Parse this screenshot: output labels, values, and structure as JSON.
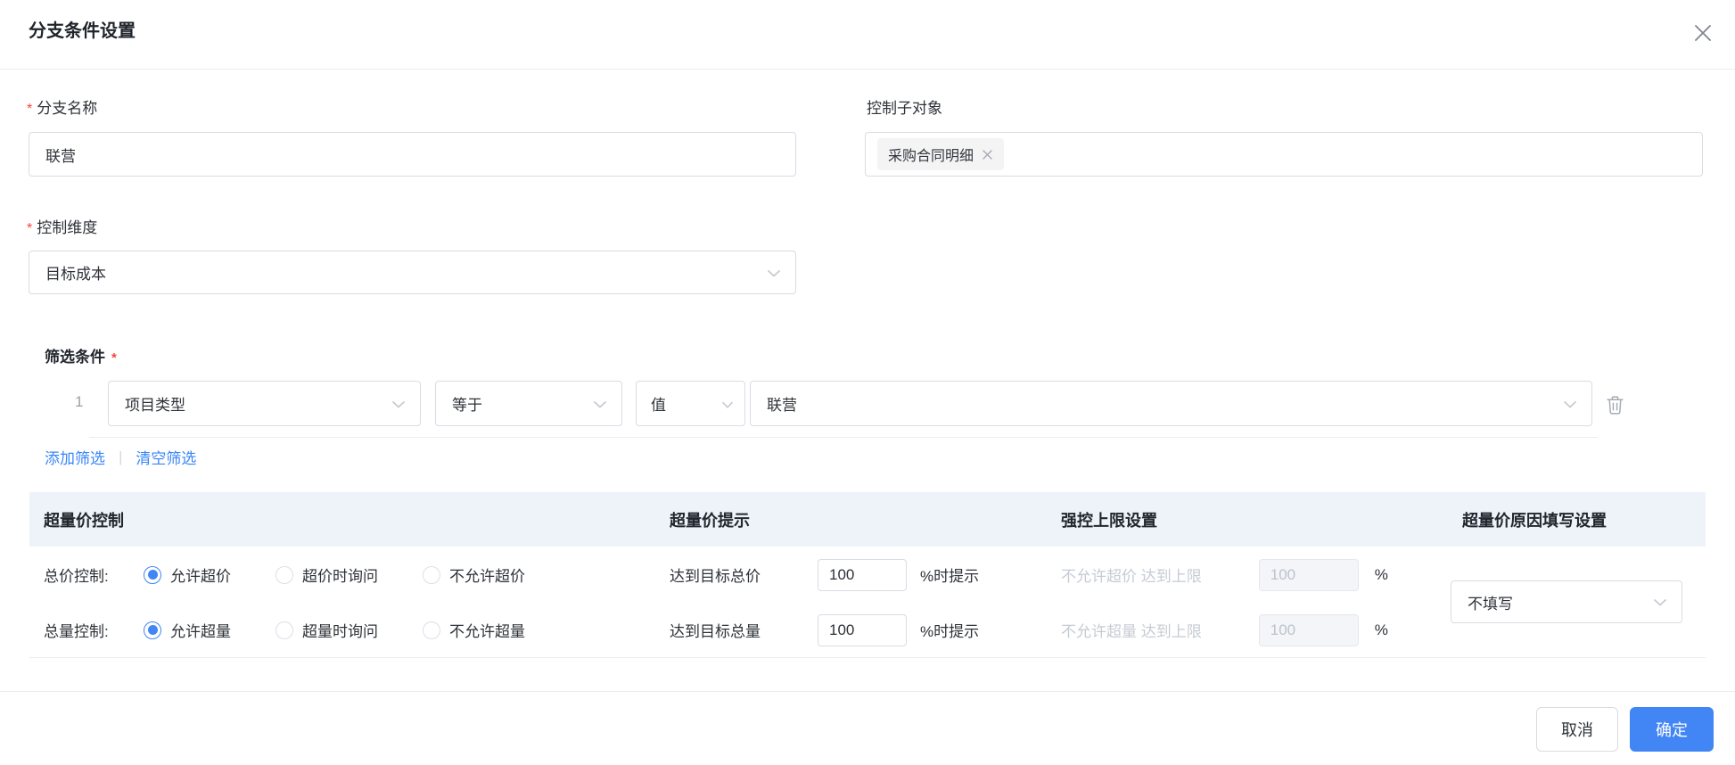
{
  "dialog": {
    "title": "分支条件设置"
  },
  "marks": {
    "required": "*",
    "link_separator": "|"
  },
  "form": {
    "branch_name": {
      "label": "分支名称",
      "value": "联营"
    },
    "control_sub_object": {
      "label": "控制子对象",
      "tag": "采购合同明细"
    },
    "control_dimension": {
      "label": "控制维度",
      "value": "目标成本"
    },
    "filter": {
      "label": "筛选条件",
      "row": {
        "index": "1",
        "field": "项目类型",
        "operator": "等于",
        "value_type": "值",
        "value": "联营"
      },
      "add_link": "添加筛选",
      "clear_link": "清空筛选"
    }
  },
  "control_table": {
    "headers": [
      "超量价控制",
      "超量价提示",
      "强控上限设置",
      "超量价原因填写设置"
    ],
    "rows": [
      {
        "label": "总价控制:",
        "options": [
          "允许超价",
          "超价时询问",
          "不允许超价"
        ],
        "selected_option": "允许超价",
        "tip_label": "达到目标总价",
        "tip_value": "100",
        "tip_suffix": "%时提示",
        "limit_text": "不允许超价 达到上限",
        "limit_value": "100",
        "limit_suffix": "%"
      },
      {
        "label": "总量控制:",
        "options": [
          "允许超量",
          "超量时询问",
          "不允许超量"
        ],
        "selected_option": "允许超量",
        "tip_label": "达到目标总量",
        "tip_value": "100",
        "tip_suffix": "%时提示",
        "limit_text": "不允许超量 达到上限",
        "limit_value": "100",
        "limit_suffix": "%"
      }
    ],
    "reason_setting": {
      "value": "不填写"
    }
  },
  "footer": {
    "cancel_label": "取消",
    "confirm_label": "确定"
  },
  "colors": {
    "accent": "#4285f4",
    "danger": "#f5483d",
    "table_header_bg": "#eef2f9",
    "border": "#d9dce3",
    "disabled_text": "#bdc3cc"
  }
}
